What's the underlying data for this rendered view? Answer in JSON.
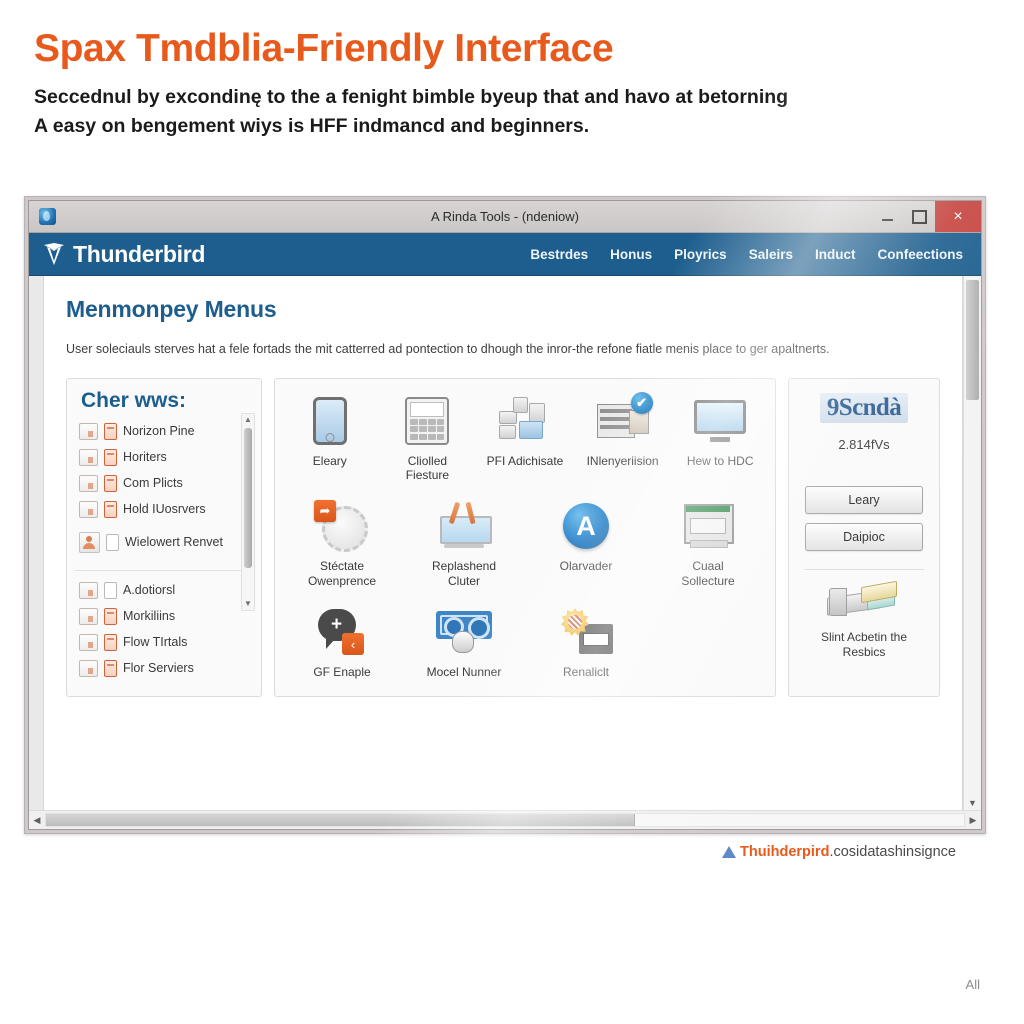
{
  "hero": {
    "title": "Spax Tmdblia-Friendly Interface",
    "subtitle_line1": "Seccednul by excondinę to the a fenight bimble byeup that and havo at betorning",
    "subtitle_line2": "A easy on bengement wiys is HFF indmancd and beginners.",
    "title_color": "#E8591C"
  },
  "window": {
    "title": "A Rinda Tools - (ndeniow)",
    "app_icon": "thunderbird-globe-icon",
    "controls": {
      "minimize": "–",
      "maximize": "❑",
      "close": "×",
      "close_color": "#C6443F"
    }
  },
  "navbar": {
    "brand": "Thunderbird",
    "brand_mark": "thunderbird-logo-icon",
    "background": "#1D5E8E",
    "links": [
      {
        "label": "Bestrdes"
      },
      {
        "label": "Honus"
      },
      {
        "label": "Ployrics"
      },
      {
        "label": "Saleirs"
      },
      {
        "label": "Induct"
      },
      {
        "label": "Confeections"
      }
    ]
  },
  "page": {
    "heading": "Menmonpey Menus",
    "heading_color": "#1D5E8E",
    "body": "User soleciauls sterves hat a fele fortads the mit catterred ad pontection to dhough the inror-the refone fiatle menis place to ger apaltnerts."
  },
  "left_panel": {
    "heading": "Cher wws:",
    "group_1": [
      {
        "label": "Norizon Pine",
        "icon": "chart-icon",
        "icon2": "pill-icon"
      },
      {
        "label": "Horiters",
        "icon": "chart-icon",
        "icon2": "pill-icon"
      },
      {
        "label": "Com Plicts",
        "icon": "chart-icon",
        "icon2": "pill-icon"
      },
      {
        "label": "Hold IUosrvers",
        "icon": "chart-icon",
        "icon2": "pill-icon"
      },
      {
        "label": "Wielowert Renvet",
        "icon": "person-icon",
        "icon2": "bookmark-icon"
      }
    ],
    "group_2": [
      {
        "label": "A.dotiorsl",
        "icon": "chart-icon",
        "icon2": "doc-icon"
      },
      {
        "label": "Morkiliins",
        "icon": "chart-icon",
        "icon2": "pill-icon"
      },
      {
        "label": "Flow TIrtals",
        "icon": "chart-icon",
        "icon2": "pill-icon"
      },
      {
        "label": "Flor Serviers",
        "icon": "chart-icon",
        "icon2": "pill-icon"
      }
    ],
    "scroll_up": "▲",
    "scroll_down": "▼"
  },
  "icon_grid": {
    "rows": [
      [
        {
          "label": "Eleary",
          "icon": "tablet-icon"
        },
        {
          "label": "Cliolled Fiesture",
          "icon": "calculator-icon"
        },
        {
          "label": "PFI Adichisate",
          "icon": "network-nodes-icon"
        },
        {
          "label": "INlenyeriision",
          "icon": "table-with-image-icon",
          "badge": "check-badge-icon",
          "badge_glyph": "✔"
        },
        {
          "label": "Hew to HDC",
          "icon": "monitor-icon"
        }
      ],
      [
        {
          "label": "Stéctate Owenprence",
          "icon": "gauge-with-tag-icon",
          "tag_glyph": "➦"
        },
        {
          "label": "Replashend Cluter",
          "icon": "easel-paintbrush-icon"
        },
        {
          "label": "Olarvader",
          "icon": "letter-a-circle-icon",
          "glyph": "A"
        },
        {
          "label": "Cuaal Sollecture",
          "icon": "app-window-icon"
        }
      ],
      [
        {
          "label": "GF Enaple",
          "icon": "chat-plus-icon",
          "tag_glyph": "‹"
        },
        {
          "label": "Mocel Nunner",
          "icon": "money-mouse-icon"
        },
        {
          "label": "Renaliclt",
          "icon": "gear-card-icon"
        }
      ]
    ]
  },
  "right_panel": {
    "logo_text": "9Scndà",
    "version": "2.814fVs",
    "buttons": [
      {
        "label": "Leary"
      },
      {
        "label": "Daipioc"
      }
    ],
    "tool_icon": "clamp-tool-icon",
    "tool_caption": "Slint Acbetin the Resbics"
  },
  "scrollbars": {
    "v_up": "▲",
    "v_down": "▼",
    "h_left": "◀",
    "h_right": "▶"
  },
  "footer": {
    "mark": "thunderbird-triangle-icon",
    "brand": "Thuihderpird",
    "domain": ".cosidatashinsignce"
  },
  "corner_note": "All"
}
